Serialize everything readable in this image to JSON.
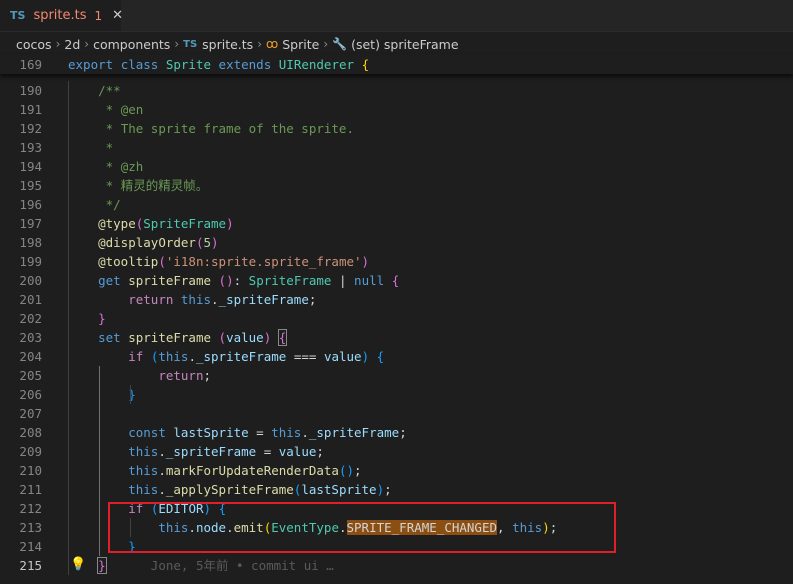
{
  "tab": {
    "lang": "TS",
    "filename": "sprite.ts",
    "problems": "1",
    "close": "✕"
  },
  "breadcrumb": {
    "items": [
      "cocos",
      "2d",
      "components",
      "sprite.ts",
      "Sprite",
      "(set) spriteFrame"
    ],
    "ts_tag": "TS"
  },
  "colors": {
    "keyword": "#569cd6",
    "control": "#c586c0",
    "type": "#4ec9b0",
    "function": "#dcdcaa",
    "variable": "#9cdcfe",
    "string": "#ce9178",
    "number": "#b5cea8",
    "comment": "#6a9955",
    "highlight_box": "#e01f2b"
  },
  "editor": {
    "blame": "Jone, 5年前 • commit ui …",
    "lines": [
      {
        "n": "169",
        "sticky": true,
        "tokens": [
          [
            "kw",
            "export"
          ],
          [
            "pu",
            " "
          ],
          [
            "kw",
            "class"
          ],
          [
            "pu",
            " "
          ],
          [
            "ty",
            "Sprite"
          ],
          [
            "pu",
            " "
          ],
          [
            "kw",
            "extends"
          ],
          [
            "pu",
            " "
          ],
          [
            "ty",
            "UIRenderer"
          ],
          [
            "pu",
            " "
          ],
          [
            "br1",
            "{"
          ]
        ]
      },
      {
        "n": "190",
        "tokens": [
          [
            "pu",
            "    "
          ],
          [
            "cm",
            "/**"
          ]
        ]
      },
      {
        "n": "191",
        "tokens": [
          [
            "pu",
            "     "
          ],
          [
            "cm",
            "* @en"
          ]
        ]
      },
      {
        "n": "192",
        "tokens": [
          [
            "pu",
            "     "
          ],
          [
            "cm",
            "* The sprite frame of the sprite."
          ]
        ]
      },
      {
        "n": "193",
        "tokens": [
          [
            "pu",
            "     "
          ],
          [
            "cm",
            "*"
          ]
        ]
      },
      {
        "n": "194",
        "tokens": [
          [
            "pu",
            "     "
          ],
          [
            "cm",
            "* @zh"
          ]
        ]
      },
      {
        "n": "195",
        "tokens": [
          [
            "pu",
            "     "
          ],
          [
            "cm",
            "* 精灵的精灵帧。"
          ]
        ]
      },
      {
        "n": "196",
        "tokens": [
          [
            "pu",
            "     "
          ],
          [
            "cm",
            "*/"
          ]
        ]
      },
      {
        "n": "197",
        "tokens": [
          [
            "pu",
            "    "
          ],
          [
            "fn",
            "@type"
          ],
          [
            "br2",
            "("
          ],
          [
            "ty",
            "SpriteFrame"
          ],
          [
            "br2",
            ")"
          ]
        ]
      },
      {
        "n": "198",
        "tokens": [
          [
            "pu",
            "    "
          ],
          [
            "fn",
            "@displayOrder"
          ],
          [
            "br2",
            "("
          ],
          [
            "nu",
            "5"
          ],
          [
            "br2",
            ")"
          ]
        ]
      },
      {
        "n": "199",
        "tokens": [
          [
            "pu",
            "    "
          ],
          [
            "fn",
            "@tooltip"
          ],
          [
            "br2",
            "("
          ],
          [
            "st",
            "'i18n:sprite.sprite_frame'"
          ],
          [
            "br2",
            ")"
          ]
        ]
      },
      {
        "n": "200",
        "tokens": [
          [
            "pu",
            "    "
          ],
          [
            "kw",
            "get"
          ],
          [
            "pu",
            " "
          ],
          [
            "fn",
            "spriteFrame"
          ],
          [
            "pu",
            " "
          ],
          [
            "br2",
            "()"
          ],
          [
            "pu",
            ": "
          ],
          [
            "ty",
            "SpriteFrame"
          ],
          [
            "pu",
            " | "
          ],
          [
            "kw",
            "null"
          ],
          [
            "pu",
            " "
          ],
          [
            "br2",
            "{"
          ]
        ]
      },
      {
        "n": "201",
        "tokens": [
          [
            "pu",
            "        "
          ],
          [
            "kc",
            "return"
          ],
          [
            "pu",
            " "
          ],
          [
            "kw",
            "this"
          ],
          [
            "pu",
            "."
          ],
          [
            "va",
            "_spriteFrame"
          ],
          [
            "pu",
            ";"
          ]
        ]
      },
      {
        "n": "202",
        "tokens": [
          [
            "pu",
            "    "
          ],
          [
            "br2",
            "}"
          ]
        ]
      },
      {
        "n": "203",
        "tokens": [
          [
            "pu",
            "    "
          ],
          [
            "kw",
            "set"
          ],
          [
            "pu",
            " "
          ],
          [
            "fn",
            "spriteFrame"
          ],
          [
            "pu",
            " "
          ],
          [
            "br2",
            "("
          ],
          [
            "va",
            "value"
          ],
          [
            "br2",
            ")"
          ],
          [
            "pu",
            " "
          ],
          [
            "br2b",
            "{"
          ]
        ]
      },
      {
        "n": "204",
        "tokens": [
          [
            "pu",
            "        "
          ],
          [
            "kc",
            "if"
          ],
          [
            "pu",
            " "
          ],
          [
            "br3",
            "("
          ],
          [
            "kw",
            "this"
          ],
          [
            "pu",
            "."
          ],
          [
            "va",
            "_spriteFrame"
          ],
          [
            "pu",
            " === "
          ],
          [
            "va",
            "value"
          ],
          [
            "br3",
            ")"
          ],
          [
            "pu",
            " "
          ],
          [
            "br3",
            "{"
          ]
        ]
      },
      {
        "n": "205",
        "tokens": [
          [
            "pu",
            "            "
          ],
          [
            "kc",
            "return"
          ],
          [
            "pu",
            ";"
          ]
        ]
      },
      {
        "n": "206",
        "tokens": [
          [
            "pu",
            "        "
          ],
          [
            "br3",
            "}"
          ]
        ]
      },
      {
        "n": "207",
        "tokens": []
      },
      {
        "n": "208",
        "tokens": [
          [
            "pu",
            "        "
          ],
          [
            "kw",
            "const"
          ],
          [
            "pu",
            " "
          ],
          [
            "va",
            "lastSprite"
          ],
          [
            "pu",
            " = "
          ],
          [
            "kw",
            "this"
          ],
          [
            "pu",
            "."
          ],
          [
            "va",
            "_spriteFrame"
          ],
          [
            "pu",
            ";"
          ]
        ]
      },
      {
        "n": "209",
        "tokens": [
          [
            "pu",
            "        "
          ],
          [
            "kw",
            "this"
          ],
          [
            "pu",
            "."
          ],
          [
            "va",
            "_spriteFrame"
          ],
          [
            "pu",
            " = "
          ],
          [
            "va",
            "value"
          ],
          [
            "pu",
            ";"
          ]
        ]
      },
      {
        "n": "210",
        "tokens": [
          [
            "pu",
            "        "
          ],
          [
            "kw",
            "this"
          ],
          [
            "pu",
            "."
          ],
          [
            "fn",
            "markForUpdateRenderData"
          ],
          [
            "br3",
            "()"
          ],
          [
            "pu",
            ";"
          ]
        ]
      },
      {
        "n": "211",
        "tokens": [
          [
            "pu",
            "        "
          ],
          [
            "kw",
            "this"
          ],
          [
            "pu",
            "."
          ],
          [
            "fn",
            "_applySpriteFrame"
          ],
          [
            "br3",
            "("
          ],
          [
            "va",
            "lastSprite"
          ],
          [
            "br3",
            ")"
          ],
          [
            "pu",
            ";"
          ]
        ]
      },
      {
        "n": "212",
        "tokens": [
          [
            "pu",
            "        "
          ],
          [
            "kc",
            "if"
          ],
          [
            "pu",
            " "
          ],
          [
            "br3",
            "("
          ],
          [
            "va",
            "EDITOR"
          ],
          [
            "br3",
            ")"
          ],
          [
            "pu",
            " "
          ],
          [
            "br3",
            "{"
          ]
        ]
      },
      {
        "n": "213",
        "tokens": [
          [
            "pu",
            "            "
          ],
          [
            "kw",
            "this"
          ],
          [
            "pu",
            "."
          ],
          [
            "va",
            "node"
          ],
          [
            "pu",
            "."
          ],
          [
            "fn",
            "emit"
          ],
          [
            "br1",
            "("
          ],
          [
            "ty",
            "EventType"
          ],
          [
            "pu",
            "."
          ],
          [
            "hl",
            "SPRITE_FRAME_CHANGED"
          ],
          [
            "pu",
            ", "
          ],
          [
            "kw",
            "this"
          ],
          [
            "br1",
            ")"
          ],
          [
            "pu",
            ";"
          ]
        ]
      },
      {
        "n": "214",
        "tokens": [
          [
            "pu",
            "        "
          ],
          [
            "br3",
            "}"
          ]
        ]
      },
      {
        "n": "215",
        "active": true,
        "tokens": [
          [
            "pu",
            "    "
          ],
          [
            "br2b",
            "}"
          ],
          [
            "pu",
            "      "
          ],
          [
            "blame",
            ""
          ]
        ]
      }
    ]
  }
}
